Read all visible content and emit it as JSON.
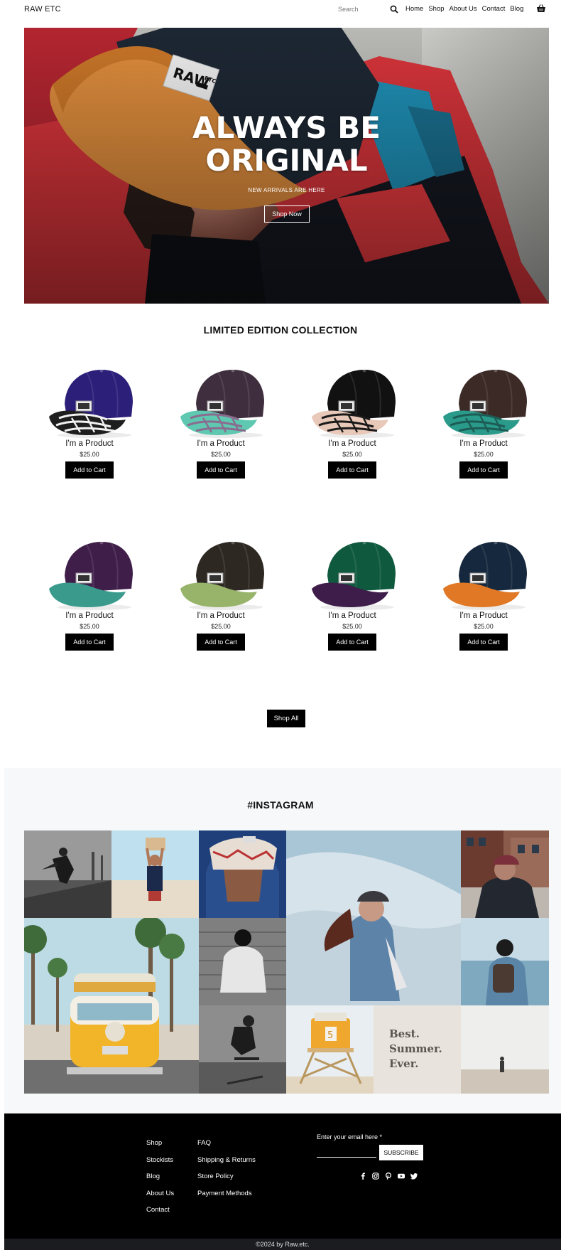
{
  "header": {
    "brand": "RAW ETC",
    "search_placeholder": "Search",
    "nav": [
      "Home",
      "Shop",
      "About Us",
      "Contact",
      "Blog"
    ]
  },
  "hero": {
    "title_line1": "ALWAYS BE",
    "title_line2": "ORIGINAL",
    "subtitle": "NEW ARRIVALS ARE HERE",
    "button": "Shop Now",
    "cap_patch": "RAW ETC"
  },
  "collection": {
    "title": "LIMITED EDITION COLLECTION",
    "products": [
      {
        "name": "I'm a Product",
        "price": "$25.00",
        "button": "Add to Cart",
        "crown": "#2b1f7a",
        "brim": "#1e1e1e",
        "brim_pattern": "#f2f2f2"
      },
      {
        "name": "I'm a Product",
        "price": "$25.00",
        "button": "Add to Cart",
        "crown": "#3f2f3e",
        "brim": "#5fc8b0",
        "brim_pattern": "#8b6b8f"
      },
      {
        "name": "I'm a Product",
        "price": "$25.00",
        "button": "Add to Cart",
        "crown": "#111111",
        "brim": "#e8c8b8",
        "brim_pattern": "#1a1a1a"
      },
      {
        "name": "I'm a Product",
        "price": "$25.00",
        "button": "Add to Cart",
        "crown": "#3b2a26",
        "brim": "#2a9a8a",
        "brim_pattern": "#1d5c55"
      },
      {
        "name": "I'm a Product",
        "price": "$25.00",
        "button": "Add to Cart",
        "crown": "#3f1f4a",
        "brim": "#3a9a8c",
        "brim_pattern": "#3a9a8c"
      },
      {
        "name": "I'm a Product",
        "price": "$25.00",
        "button": "Add to Cart",
        "crown": "#2e2822",
        "brim": "#97b46a",
        "brim_pattern": "#97b46a"
      },
      {
        "name": "I'm a Product",
        "price": "$25.00",
        "button": "Add to Cart",
        "crown": "#0f5a3e",
        "brim": "#3f1d4a",
        "brim_pattern": "#3f1d4a"
      },
      {
        "name": "I'm a Product",
        "price": "$25.00",
        "button": "Add to Cart",
        "crown": "#16283d",
        "brim": "#e07826",
        "brim_pattern": "#e07826"
      }
    ],
    "shop_all": "Shop All"
  },
  "instagram": {
    "title": "#INSTAGRAM",
    "summer_text_1": "Best.",
    "summer_text_2": "Summer.",
    "summer_text_3": "Ever.",
    "tower_number": "5"
  },
  "footer": {
    "col1": [
      "Shop",
      "Stockists",
      "Blog",
      "About Us",
      "Contact"
    ],
    "col2": [
      "FAQ",
      "Shipping & Returns",
      "Store Policy",
      "Payment Methods"
    ],
    "email_label": "Enter your email here *",
    "subscribe": "SUBSCRIBE",
    "socials": [
      "facebook-icon",
      "instagram-icon",
      "pinterest-icon",
      "youtube-icon",
      "twitter-icon"
    ],
    "copyright": "©2024 by Raw.etc."
  }
}
